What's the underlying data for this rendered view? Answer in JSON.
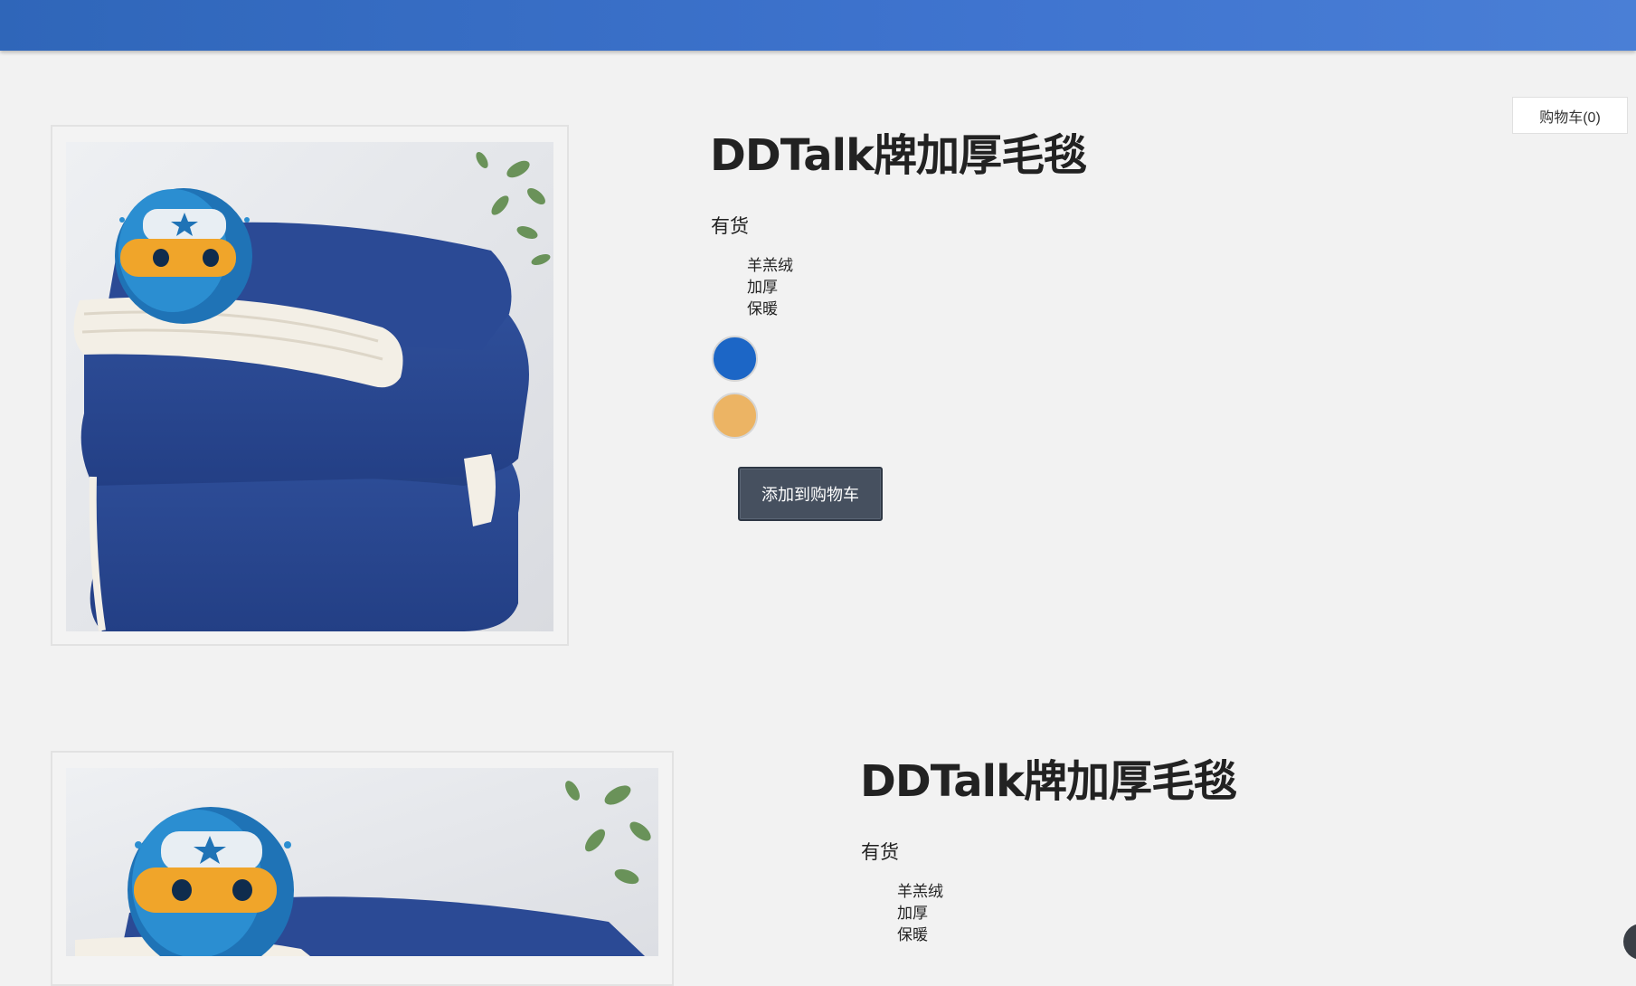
{
  "header": {
    "bar_color": "#3b70c8"
  },
  "cart": {
    "label": "购物车(0)"
  },
  "products": [
    {
      "title": "DDTalk牌加厚毛毯",
      "stock": "有货",
      "features": [
        "羊羔绒",
        "加厚",
        "保暖"
      ],
      "swatches": [
        {
          "name": "blue",
          "color": "#1c66c6"
        },
        {
          "name": "orange",
          "color": "#ecb464"
        }
      ],
      "add_to_cart_label": "添加到购物车"
    },
    {
      "title": "DDTalk牌加厚毛毯",
      "stock": "有货",
      "features": [
        "羊羔绒",
        "加厚",
        "保暖"
      ]
    }
  ],
  "icons": {
    "mascot": "ninja-mascot-icon",
    "corner_widget": "chat-widget-icon"
  }
}
